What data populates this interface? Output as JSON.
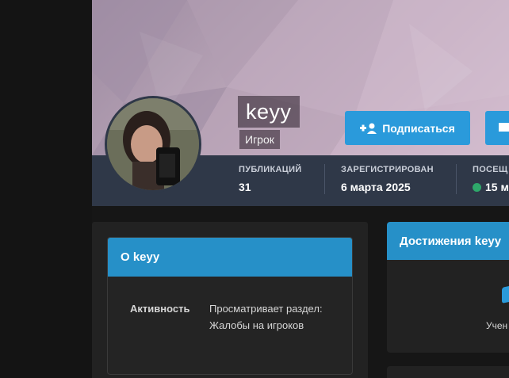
{
  "profile": {
    "username": "keyy",
    "role": "Игрок",
    "follow_label": "Подписаться"
  },
  "stats": [
    {
      "label": "ПУБЛИКАЦИЙ",
      "value": "31"
    },
    {
      "label": "ЗАРЕГИСТРИРОВАН",
      "value": "6 марта 2025"
    },
    {
      "label": "ПОСЕЩ",
      "value": "15 ми"
    }
  ],
  "about": {
    "title": "О keyy",
    "rows": [
      {
        "key": "Активность",
        "value": "Просматривает раздел: Жалобы на игроков"
      }
    ]
  },
  "achievements": {
    "title": "Достижения keyy",
    "item_label": "Учен"
  },
  "colors": {
    "accent": "#2a9adb",
    "header_blue": "#2690c8",
    "stats_bar": "#2f3848",
    "online": "#2ea86a",
    "background": "#161616"
  },
  "icons": {
    "follow": "user-plus-icon",
    "message": "envelope-icon",
    "online": "online-dot-icon",
    "achievement": "achievement-icon"
  }
}
